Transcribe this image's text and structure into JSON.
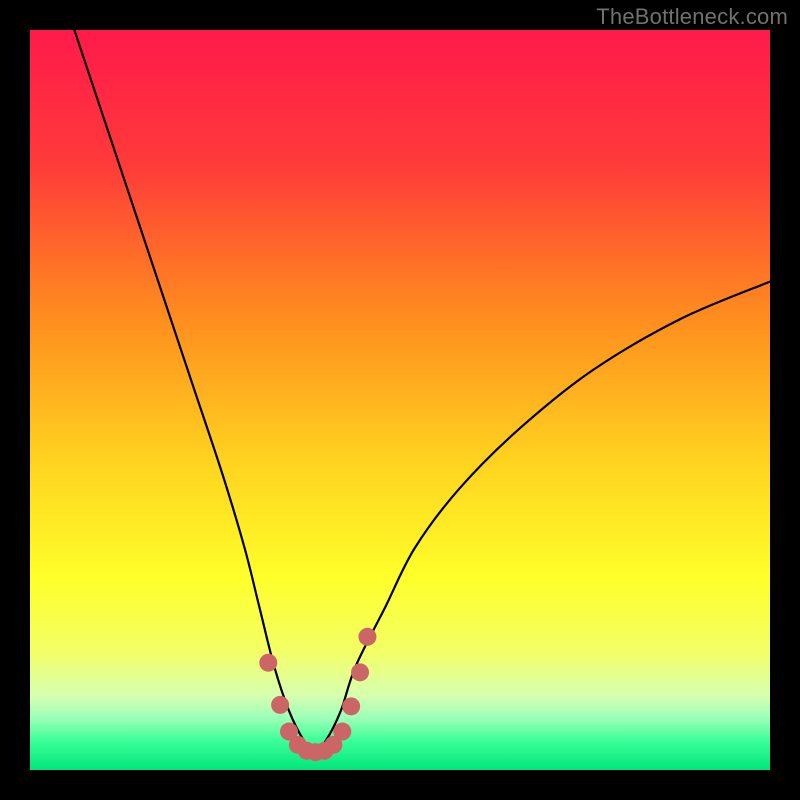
{
  "watermark": "TheBottleneck.com",
  "chart_data": {
    "type": "line",
    "title": "",
    "xlabel": "",
    "ylabel": "",
    "xlim": [
      0,
      100
    ],
    "ylim": [
      0,
      100
    ],
    "series": [
      {
        "name": "bottleneck-curve",
        "x": [
          6,
          10,
          14,
          18,
          22,
          26,
          29,
          31,
          33,
          35,
          37,
          38.5,
          40,
          42,
          44,
          48,
          52,
          58,
          66,
          76,
          88,
          100
        ],
        "y": [
          100,
          88,
          76,
          64,
          52,
          40,
          30,
          22,
          14,
          8,
          4,
          2.5,
          4,
          8,
          14,
          22,
          30,
          38,
          46,
          54,
          61,
          66
        ]
      }
    ],
    "trough": {
      "x_center": 38.5,
      "y": 2.5
    },
    "highlight_points": {
      "name": "trough-dots",
      "color": "#cc6666",
      "points": [
        {
          "x": 32.2,
          "y": 14.5
        },
        {
          "x": 33.8,
          "y": 8.8
        },
        {
          "x": 35.0,
          "y": 5.2
        },
        {
          "x": 36.2,
          "y": 3.4
        },
        {
          "x": 37.4,
          "y": 2.6
        },
        {
          "x": 38.6,
          "y": 2.4
        },
        {
          "x": 39.8,
          "y": 2.6
        },
        {
          "x": 41.0,
          "y": 3.4
        },
        {
          "x": 42.2,
          "y": 5.2
        },
        {
          "x": 43.4,
          "y": 8.6
        },
        {
          "x": 44.6,
          "y": 13.2
        },
        {
          "x": 45.6,
          "y": 18.0
        }
      ]
    },
    "background_gradient": {
      "stops": [
        {
          "pct": 0,
          "color": "#ff1a4b"
        },
        {
          "pct": 18,
          "color": "#ff3a3a"
        },
        {
          "pct": 38,
          "color": "#ff8a1f"
        },
        {
          "pct": 58,
          "color": "#ffd21f"
        },
        {
          "pct": 74,
          "color": "#ffff2a"
        },
        {
          "pct": 84,
          "color": "#f3ff66"
        },
        {
          "pct": 90,
          "color": "#d6ffb0"
        },
        {
          "pct": 93,
          "color": "#9cffb8"
        },
        {
          "pct": 96,
          "color": "#3cff99"
        },
        {
          "pct": 100,
          "color": "#00e67a"
        }
      ]
    }
  }
}
